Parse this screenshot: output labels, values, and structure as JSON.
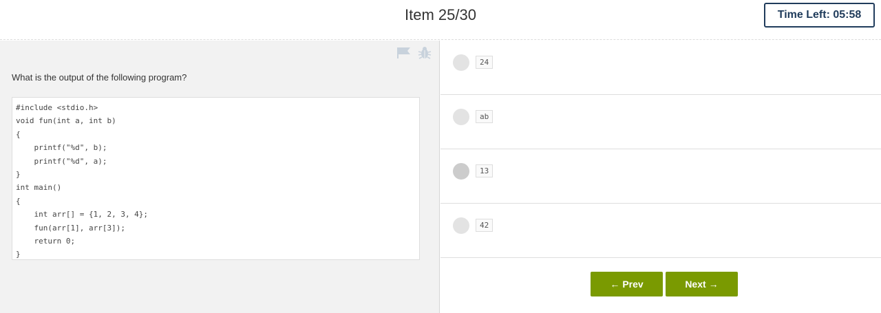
{
  "header": {
    "item_counter": "Item 25/30",
    "timer": "Time Left: 05:58"
  },
  "toolbar": {
    "icons": [
      "flag-icon",
      "bug-icon"
    ]
  },
  "question": {
    "prompt": "What is the output of the following program?",
    "code_lines": [
      "#include <stdio.h>",
      "void fun(int a, int b)",
      "{",
      "    printf(\"%d\", b);",
      "    printf(\"%d\", a);",
      "}",
      "int main()",
      "{",
      "    int arr[] = {1, 2, 3, 4};",
      "    fun(arr[1], arr[3]);",
      "    return 0;",
      "}"
    ]
  },
  "options": [
    {
      "label": "24"
    },
    {
      "label": "ab"
    },
    {
      "label": "13"
    },
    {
      "label": "42"
    }
  ],
  "nav": {
    "prev_label": "Prev",
    "next_label": "Next",
    "prev_arrow": "←",
    "next_arrow": "→"
  },
  "colors": {
    "accent_green": "#7a9a01",
    "timer_navy": "#1f3b5b",
    "left_panel_bg": "#f2f2f2"
  }
}
